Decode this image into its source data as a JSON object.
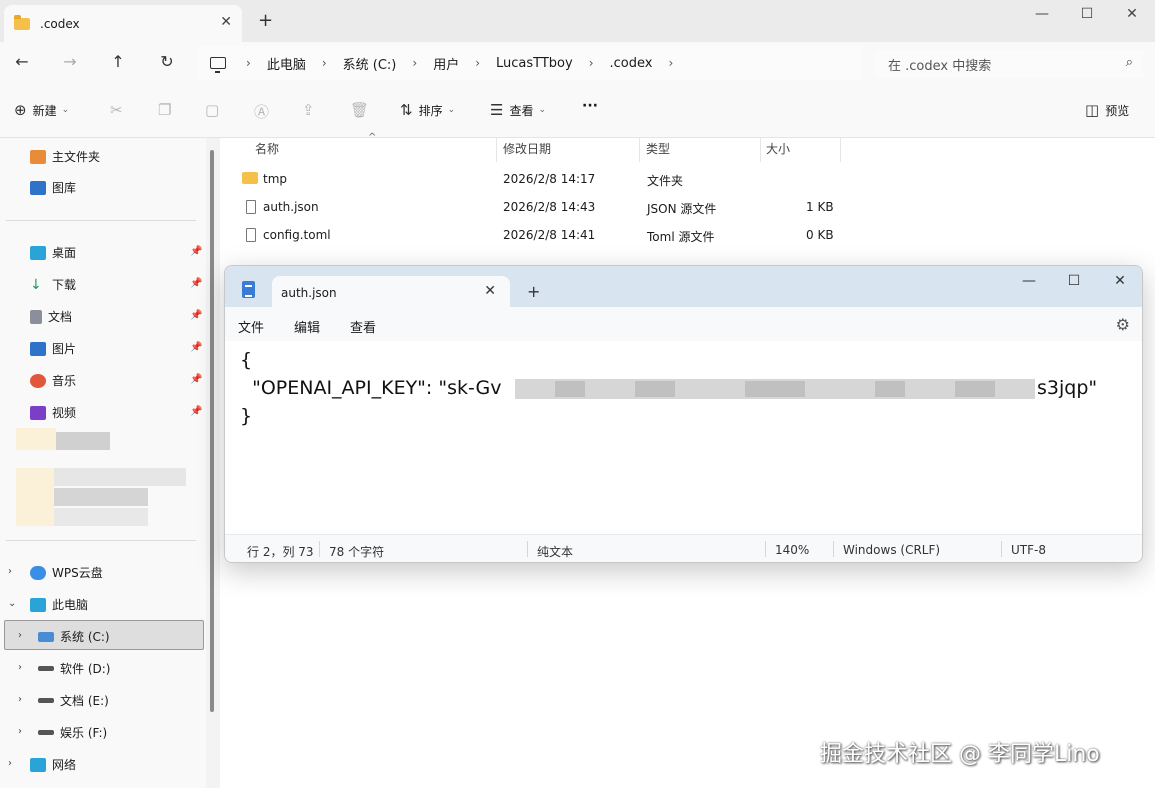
{
  "explorer": {
    "tab_title": ".codex",
    "breadcrumb": [
      "此电脑",
      "系统 (C:)",
      "用户",
      "LucasTTboy",
      ".codex"
    ],
    "search_placeholder": "在 .codex 中搜索",
    "toolbar": {
      "new_label": "新建",
      "sort_label": "排序",
      "view_label": "查看",
      "more_label": "···",
      "preview_label": "预览"
    },
    "sidebar": {
      "quick": [
        "主文件夹",
        "图库"
      ],
      "pinned": [
        "桌面",
        "下载",
        "文档",
        "图片",
        "音乐",
        "视频"
      ],
      "tree": [
        "WPS云盘",
        "此电脑",
        "系统 (C:)",
        "软件 (D:)",
        "文档 (E:)",
        "娱乐 (F:)",
        "网络"
      ]
    },
    "columns": {
      "name": "名称",
      "modified": "修改日期",
      "type": "类型",
      "size": "大小"
    },
    "files": [
      {
        "name": "tmp",
        "modified": "2026/2/8 14:17",
        "type": "文件夹",
        "size": ""
      },
      {
        "name": "auth.json",
        "modified": "2026/2/8 14:43",
        "type": "JSON 源文件",
        "size": "1 KB"
      },
      {
        "name": "config.toml",
        "modified": "2026/2/8 14:41",
        "type": "Toml 源文件",
        "size": "0 KB"
      }
    ]
  },
  "notepad": {
    "tab_title": "auth.json",
    "menu": [
      "文件",
      "编辑",
      "查看"
    ],
    "lines": [
      "{",
      "  \"OPENAI_API_KEY\": \"sk-Gv",
      "s3jqp\"",
      "}"
    ],
    "status": {
      "position": "行 2，列 73",
      "chars": "78 个字符",
      "format": "纯文本",
      "zoom": "140%",
      "line_ending": "Windows (CRLF)",
      "encoding": "UTF-8"
    }
  },
  "watermark": "掘金技术社区 @ 李同学Lino"
}
